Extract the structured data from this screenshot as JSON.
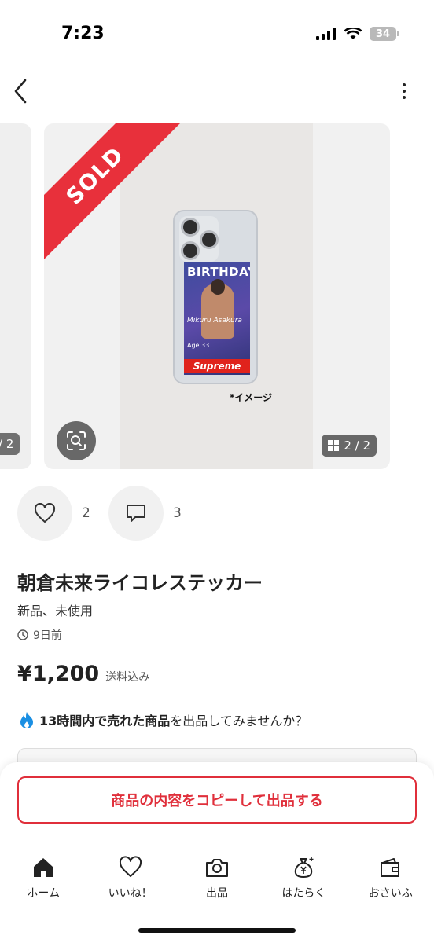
{
  "status_bar": {
    "time": "7:23",
    "battery": "34"
  },
  "carousel": {
    "sold_label": "SOLD",
    "prev_counter": "/ 2",
    "counter": "2 / 2",
    "image": {
      "sticker_heading": "BIRTHDAY",
      "sticker_name": "Mikuru Asakura",
      "sticker_age": "Age 33",
      "brand": "Supreme",
      "note": "*イメージ"
    }
  },
  "actions": {
    "likes": "2",
    "comments": "3"
  },
  "product": {
    "title": "朝倉未来ライコレステッカー",
    "condition": "新品、未使用",
    "posted": "9日前",
    "price": "¥1,200",
    "shipping": "送料込み"
  },
  "promo": {
    "bold": "13時間内で売れた商品",
    "rest": "を出品してみませんか？"
  },
  "copy_button": "商品の内容をコピーして出品する",
  "tabbar": [
    {
      "label": "ホーム",
      "icon": "home-icon"
    },
    {
      "label": "いいね！",
      "icon": "heart-icon"
    },
    {
      "label": "出品",
      "icon": "camera-icon"
    },
    {
      "label": "はたらく",
      "icon": "money-bag-icon"
    },
    {
      "label": "おさいふ",
      "icon": "wallet-icon"
    }
  ],
  "colors": {
    "accent": "#e02f3b",
    "sold": "#e8303b"
  }
}
